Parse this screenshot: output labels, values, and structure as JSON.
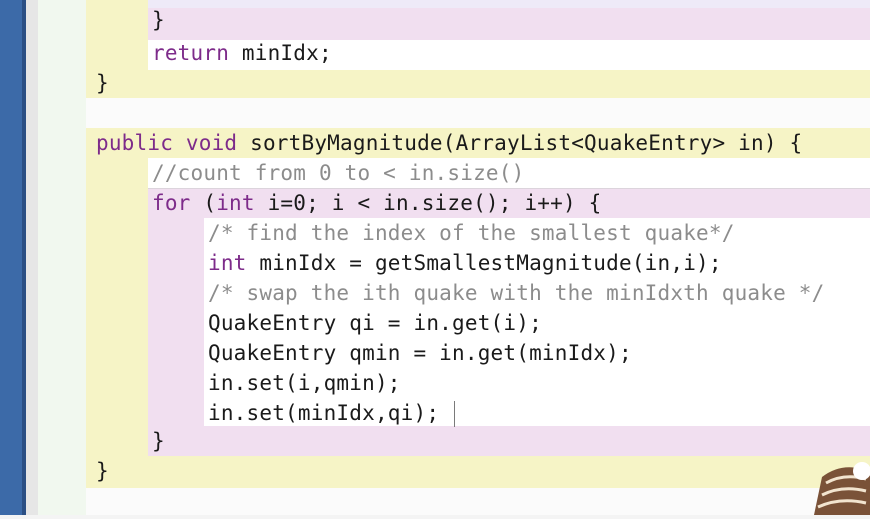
{
  "code": {
    "l1_close": "}",
    "l2_kw": "return",
    "l2_rest": " minIdx;",
    "l3_close": "}",
    "l4_kw1": "public",
    "l4_kw2": "void",
    "l4_rest": " sortByMagnitude(ArrayList<QuakeEntry> in) {",
    "l5_comment": "//count from 0 to < in.size()",
    "l6_kw1": "for",
    "l6_mid": " (",
    "l6_kw2": "int",
    "l6_rest": " i=0; i < in.size(); i++) {",
    "l7_comment": "/* find the index of the smallest quake*/",
    "l8_kw": "int",
    "l8_rest": " minIdx = getSmallestMagnitude(in,i);",
    "l9_comment": "/* swap the ith quake with the minIdxth quake */",
    "l10": "QuakeEntry qi = in.get(i);",
    "l11": "QuakeEntry qmin = in.get(minIdx);",
    "l12": "in.set(i,qmin);",
    "l13": "in.set(minIdx,qi);",
    "l14_close": "}",
    "l15_close": "}"
  },
  "colors": {
    "keyword": "#7d2b8a",
    "comment": "#8c8c8c",
    "method_block": "#f6f4c6",
    "loop_block": "#f1dff0",
    "inner_block": "#ffffff",
    "left_bar": "#3c6aa8"
  },
  "icons": {
    "corner": "person-figure-icon"
  }
}
